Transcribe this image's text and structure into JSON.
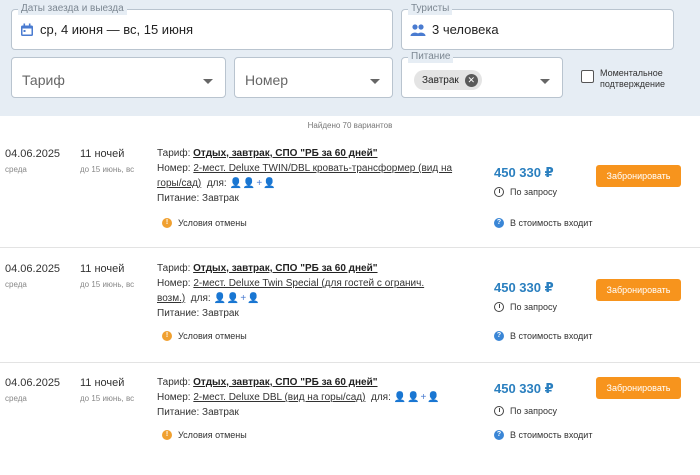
{
  "search": {
    "dates": {
      "label": "Даты заезда и выезда",
      "value": "ср, 4 июня — вс, 15 июня",
      "icon": "calendar-icon"
    },
    "tourists": {
      "label": "Туристы",
      "value": "3 человека",
      "icon": "people-icon"
    },
    "tariff": {
      "placeholder": "Тариф"
    },
    "room": {
      "placeholder": "Номер"
    },
    "meal": {
      "label": "Питание",
      "chip": "Завтрак"
    },
    "instant": {
      "label_line1": "Моментальное",
      "label_line2": "подтверждение",
      "checked": false
    }
  },
  "found_text": "Найдено 70 вариантов",
  "results": [
    {
      "date": "04.06.2025",
      "dow": "среда",
      "nights": "11 ночей",
      "until": "до 15 июнь, вс",
      "tariff_key": "Тариф:",
      "tariff": "Отдых, завтрак, СПО \"РБ за 60 дней\"",
      "room_key": "Номер:",
      "room": "2-мест. Deluxe TWIN/DBL кровать-трансформер (вид на горы/сад)",
      "for_label": "для:",
      "people": "👤👤+👤",
      "meal_key": "Питание:",
      "meal": "Завтрак",
      "cancel": "Условия отмены",
      "price": "450 330 ₽",
      "request": "По запросу",
      "included": "В стоимость входит",
      "book": "Забронировать"
    },
    {
      "date": "04.06.2025",
      "dow": "среда",
      "nights": "11 ночей",
      "until": "до 15 июнь, вс",
      "tariff_key": "Тариф:",
      "tariff": "Отдых, завтрак, СПО \"РБ за 60 дней\"",
      "room_key": "Номер:",
      "room": "2-мест. Deluxe Twin Special (для гостей с огранич. возм.)",
      "for_label": "для:",
      "people": "👤👤+👤",
      "meal_key": "Питание:",
      "meal": "Завтрак",
      "cancel": "Условия отмены",
      "price": "450 330 ₽",
      "request": "По запросу",
      "included": "В стоимость входит",
      "book": "Забронировать"
    },
    {
      "date": "04.06.2025",
      "dow": "среда",
      "nights": "11 ночей",
      "until": "до 15 июнь, вс",
      "tariff_key": "Тариф:",
      "tariff": "Отдых, завтрак, СПО \"РБ за 60 дней\"",
      "room_key": "Номер:",
      "room": "2-мест. Deluxe DBL (вид на горы/сад)",
      "for_label": "для:",
      "people": "👤👤+👤",
      "meal_key": "Питание:",
      "meal": "Завтрак",
      "cancel": "Условия отмены",
      "price": "450 330 ₽",
      "request": "По запросу",
      "included": "В стоимость входит",
      "book": "Забронировать"
    }
  ],
  "colors": {
    "accent": "#f7941d",
    "price": "#2a7fbf",
    "panel": "#e6edf4"
  }
}
